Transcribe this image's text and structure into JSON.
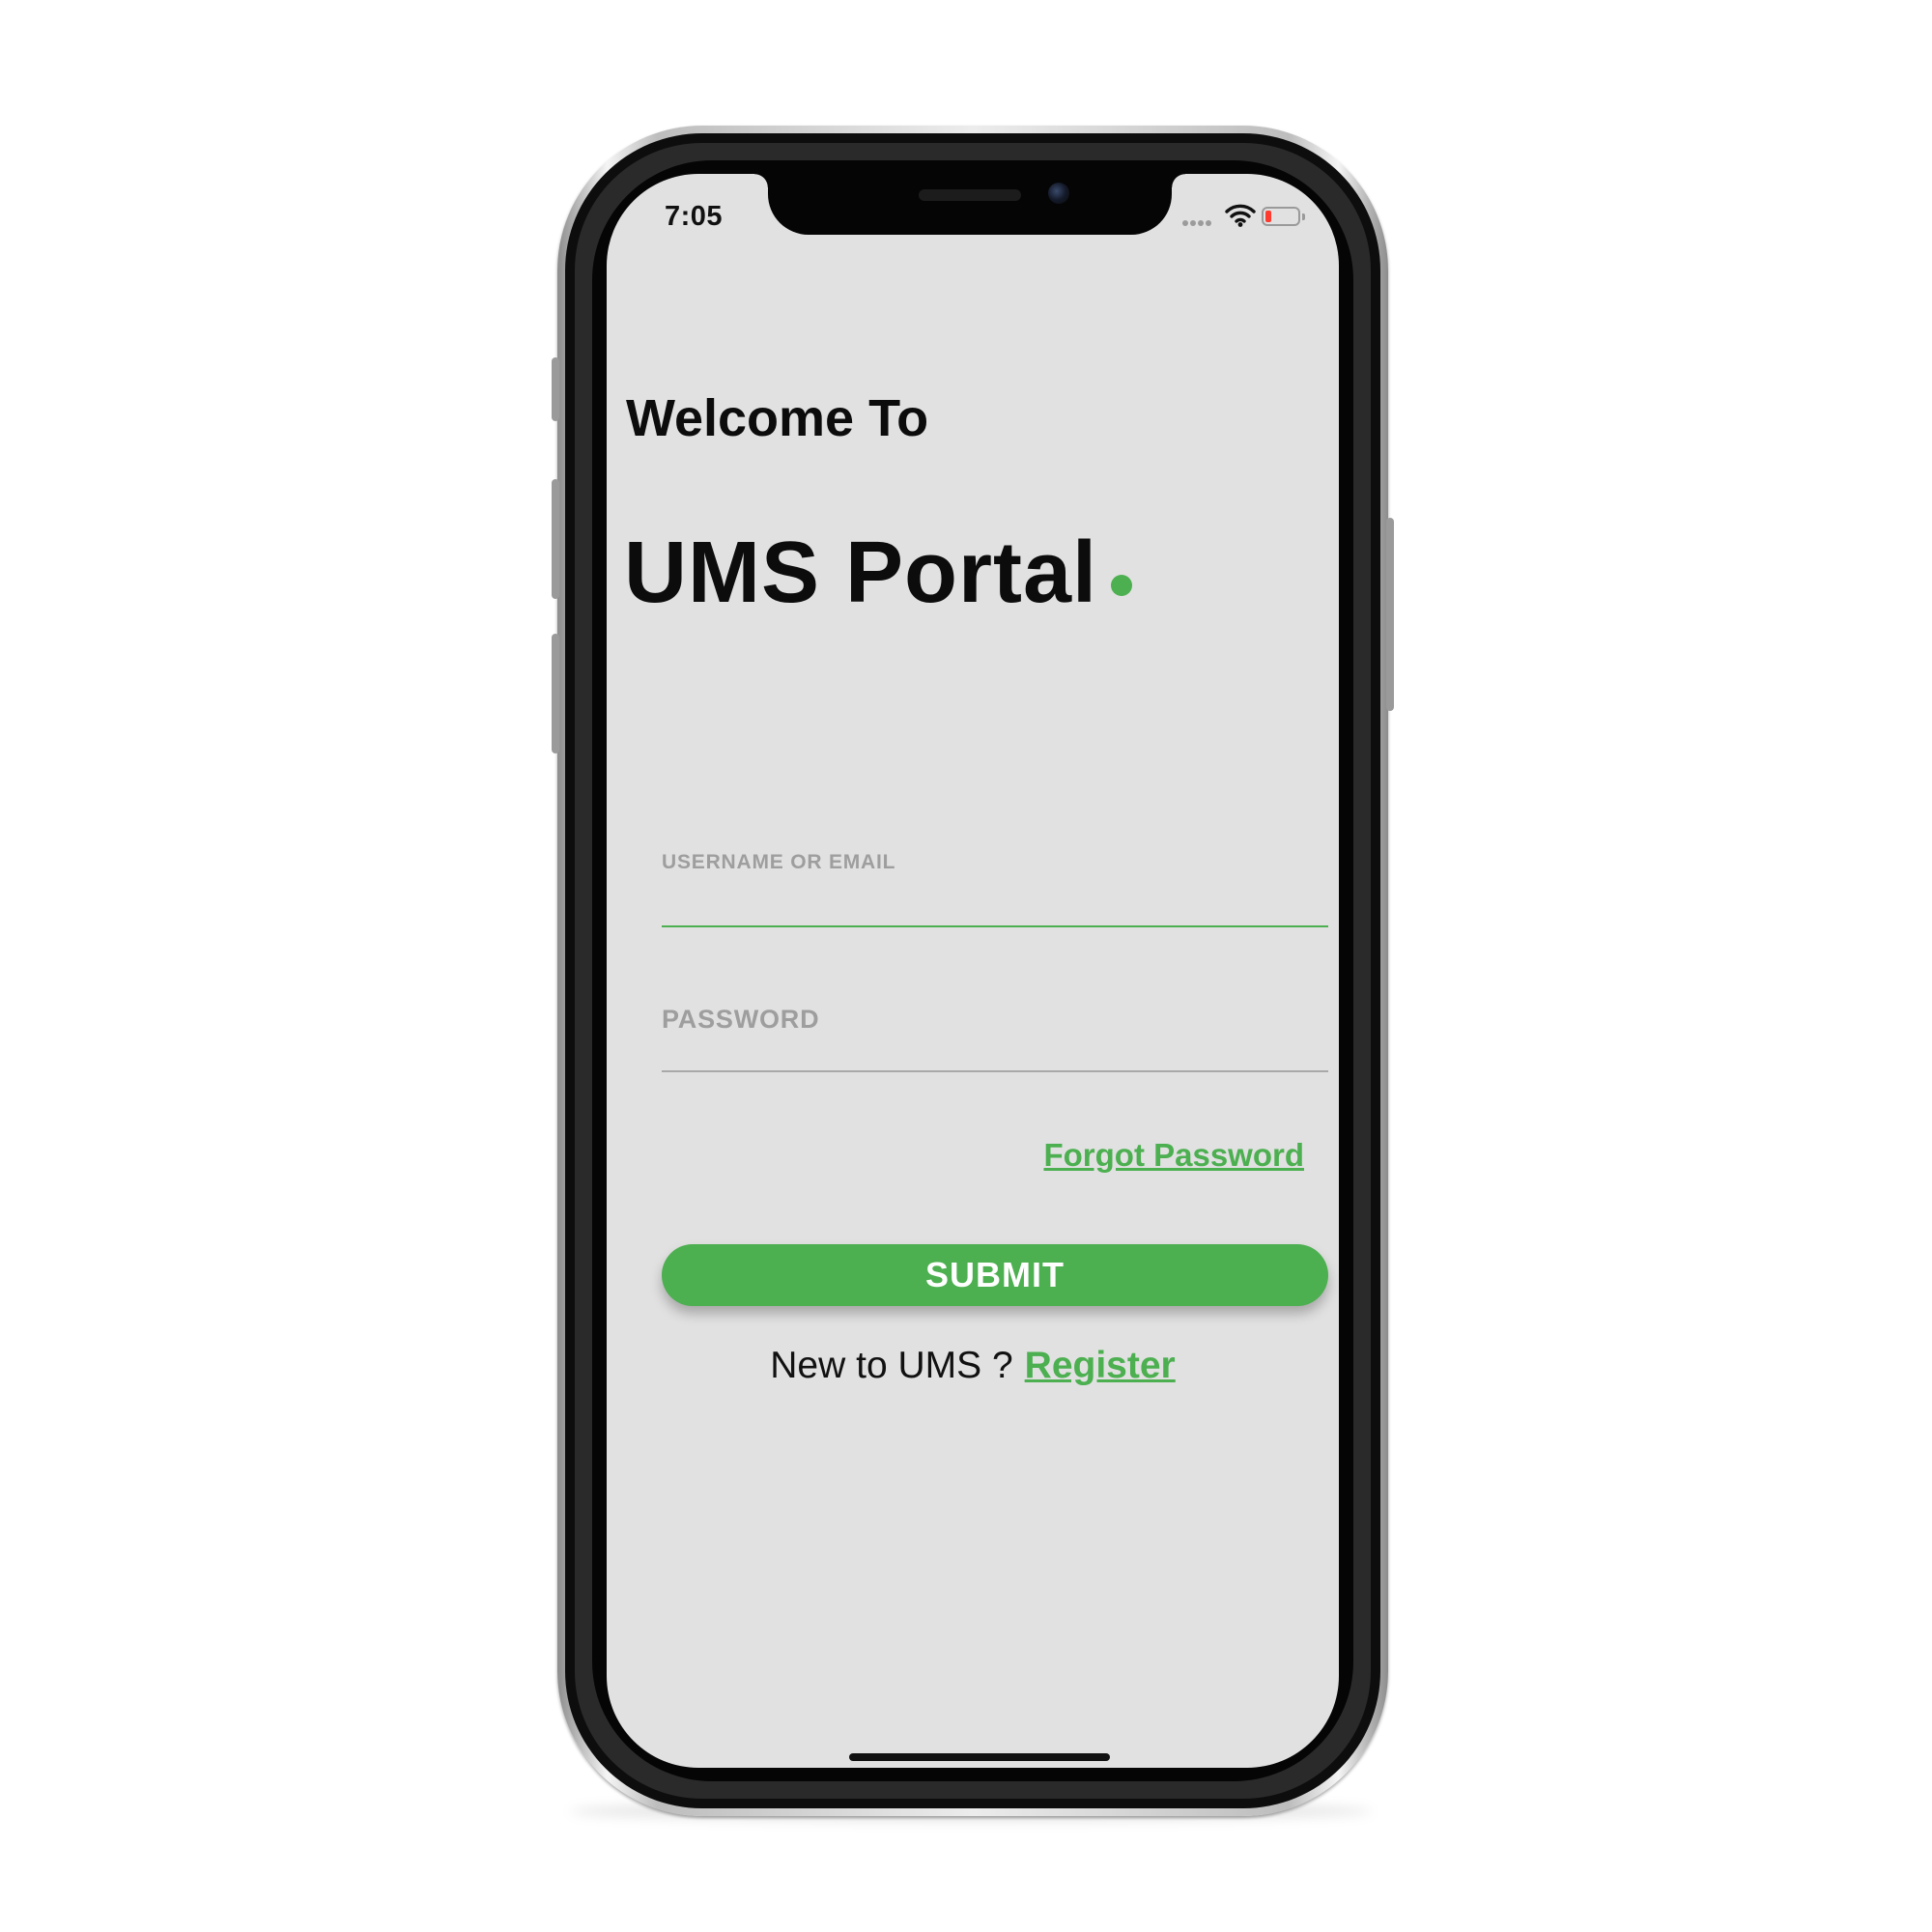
{
  "status_bar": {
    "time": "7:05",
    "signal_icon": "signal-dots-icon",
    "wifi_icon": "wifi-icon",
    "battery_icon": "battery-low-icon",
    "battery_color": "#ff3b30"
  },
  "header": {
    "welcome": "Welcome To",
    "app_title": "UMS Portal",
    "accent_dot_color": "#4caf50"
  },
  "form": {
    "username_label": "USERNAME OR EMAIL",
    "username_value": "",
    "password_label": "PASSWORD",
    "password_value": "",
    "forgot_password": "Forgot Password",
    "submit_label": "SUBMIT"
  },
  "register": {
    "prompt": "New to UMS ?",
    "link": "Register"
  },
  "colors": {
    "accent": "#4caf50",
    "screen_background": "#e1e1e1",
    "label_gray": "#9e9e9e"
  }
}
